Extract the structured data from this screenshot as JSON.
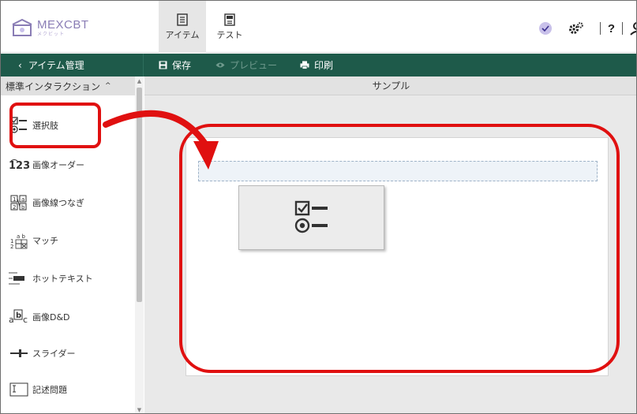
{
  "app": {
    "logo_title": "MEXCBT",
    "logo_subtitle": "メクビット"
  },
  "topnav": [
    {
      "label": "アイテム",
      "active": true
    },
    {
      "label": "テスト",
      "active": false
    }
  ],
  "topright": {
    "help_label": "?"
  },
  "toolbar": {
    "back_label": "アイテム管理",
    "save_label": "保存",
    "preview_label": "プレビュー",
    "print_label": "印刷"
  },
  "sidebar": {
    "header": "標準インタラクション",
    "items": [
      {
        "label": "選択肢",
        "icon": "multiple-choice-icon"
      },
      {
        "label": "画像オーダー",
        "icon": "order-icon"
      },
      {
        "label": "画像線つなぎ",
        "icon": "line-connect-icon"
      },
      {
        "label": "マッチ",
        "icon": "match-icon"
      },
      {
        "label": "ホットテキスト",
        "icon": "hottext-icon"
      },
      {
        "label": "画像D&D",
        "icon": "drag-drop-icon"
      },
      {
        "label": "スライダー",
        "icon": "slider-icon"
      },
      {
        "label": "記述問題",
        "icon": "text-entry-icon"
      }
    ]
  },
  "main": {
    "header": "サンプル"
  },
  "colors": {
    "toolbar_green": "#1e5a4a",
    "annotation_red": "#e01010",
    "logo_purple": "#8a7db5"
  }
}
